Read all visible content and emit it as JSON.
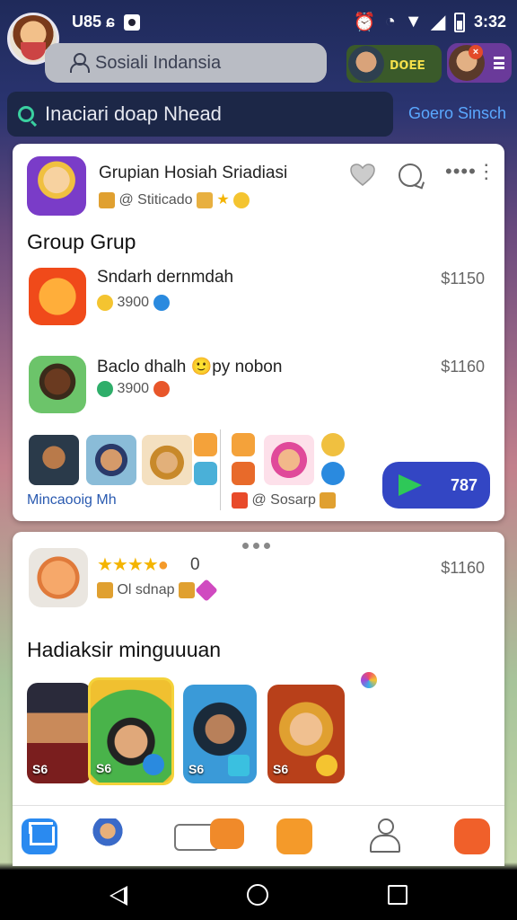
{
  "status_bar": {
    "left_text": "U85 ɕ",
    "time": "3:32"
  },
  "header": {
    "search_placeholder": "Sosiali Indansia",
    "pill_label": "ᴅᴏᴇᴇ",
    "search2_text": "Inaciari doap Nhead",
    "search2_link": "Goero Sinsch"
  },
  "card1": {
    "title": "Grupian Hosiah Sriadiasi",
    "subtitle": "@ Stiticado",
    "section_heading": "Group Grup",
    "items": [
      {
        "title": "Sndarh dernmdah",
        "meta": "3900",
        "price": "$1150"
      },
      {
        "title": "Baclo dhalh 🙂py nobon",
        "meta": "3900",
        "price": "$1160"
      }
    ],
    "footer_left_label": "Mincaooig Mh",
    "footer_right_label": "@ Sosarp",
    "cta_label": "787"
  },
  "card2": {
    "rating_suffix": "0",
    "meta": "Ol sdnap",
    "price": "$1160",
    "section_heading": "Hadiaksir minguuuan",
    "games": [
      {
        "label": "S6"
      },
      {
        "label": "S6"
      },
      {
        "label": "S6"
      },
      {
        "label": "S6"
      }
    ]
  },
  "colors": {
    "accent": "#3346c4",
    "cta_play": "#2ec858",
    "link": "#5aa8ff"
  }
}
